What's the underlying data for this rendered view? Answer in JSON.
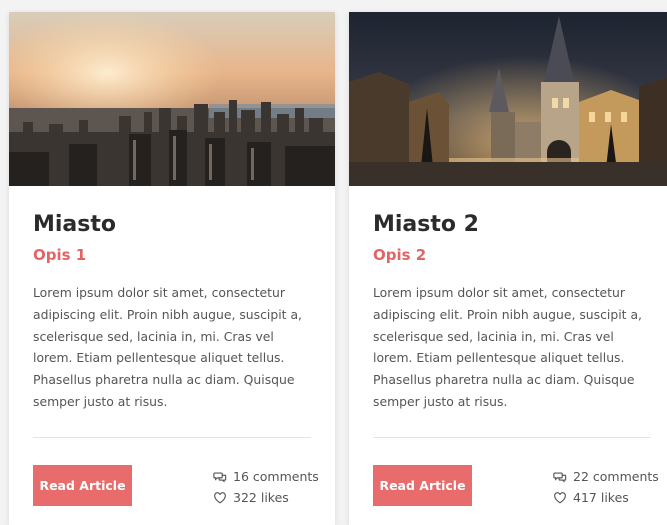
{
  "cards": [
    {
      "image": "city skyline at sunset",
      "title": "Miasto",
      "subtitle": "Opis 1",
      "body": "Lorem ipsum dolor sit amet, consectetur adipiscing elit. Proin nibh augue, suscipit a, scelerisque sed, lacinia in, mi. Cras vel lorem. Etiam pellentesque aliquet tellus. Phasellus pharetra nulla ac diam. Quisque semper justo at risus.",
      "button_label": "Read Article",
      "comments_count": "16",
      "comments_label": "comments",
      "likes_count": "322",
      "likes_label": "likes"
    },
    {
      "image": "old town gothic tower at night",
      "title": "Miasto 2",
      "subtitle": "Opis 2",
      "body": "Lorem ipsum dolor sit amet, consectetur adipiscing elit. Proin nibh augue, suscipit a, scelerisque sed, lacinia in, mi. Cras vel lorem. Etiam pellentesque aliquet tellus. Phasellus pharetra nulla ac diam. Quisque semper justo at risus.",
      "button_label": "Read Article",
      "comments_count": "22",
      "comments_label": "comments",
      "likes_count": "417",
      "likes_label": "likes"
    }
  ],
  "colors": {
    "accent": "#e96c6c",
    "subtitle": "#e06666",
    "title": "#2b2b2b",
    "body_text": "#555555",
    "card_bg": "#ffffff",
    "page_bg": "#f3f3f3"
  },
  "icons": {
    "comments": "comment-bubbles-icon",
    "likes": "heart-icon"
  }
}
